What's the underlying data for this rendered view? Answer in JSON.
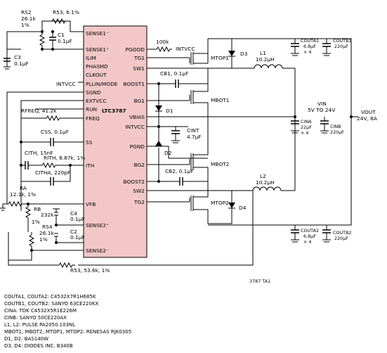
{
  "ic": {
    "part": "LTC3787",
    "pins_left": [
      "SENSE1⁻",
      "SENSE1⁺",
      "ILIM",
      "PHASMD",
      "CLKOUT",
      "PLLIN/MODE",
      "SGND",
      "EXTVCC",
      "RUN",
      "FREQ",
      "SS",
      "ITH",
      "VFB",
      "SENSE2⁺",
      "SENSE2⁻"
    ],
    "pins_right": [
      "PGOOD",
      "TG1",
      "SW1",
      "BOOST1",
      "BG1",
      "VBIAS",
      "INTVCC",
      "PGND",
      "BG2",
      "BOOST2",
      "SW2",
      "TG2"
    ]
  },
  "components": {
    "rs2": "RS2",
    "rs2_val": "26.1k",
    "rs2_val2": "1%",
    "r53a": "R53, 6.1%",
    "r53b": "R53, 53.6k, 1%",
    "c1": "C1",
    "c1_val": "0.1µF",
    "c3": "C3",
    "c3_val": "0.1µF",
    "pgood_r": "100k",
    "intvcc_label": "INTVCC",
    "intvcc_left": "INTVCC",
    "cb1": "CB1, 0.1µF",
    "cb2": "CB2, 0.1µF",
    "rfreq": "RFREQ, 41.2k",
    "css": "CSS, 0.1µF",
    "cith": "CITH, 15nF",
    "rith": "RITH, 8.87k, 1%",
    "citha": "CITHA, 220pF",
    "ra": "RA",
    "ra_val": "12.1k, 1%",
    "rb": "RB",
    "rb_val": "232k",
    "rb_val2": "1%",
    "c4": "C4",
    "c4_val": "0.1µF",
    "c2": "C2",
    "c2_val": "0.1µF",
    "rs4": "RS4",
    "rs4_val": "26.1k",
    "rs4_val2": "1%",
    "cint": "CINT",
    "cint_val": "4.7µF",
    "d1": "D1",
    "d2": "D2",
    "d3": "D3",
    "d4": "D4",
    "mtop1": "MTOP1",
    "mbot1": "MBOT1",
    "mbot2": "MBOT2",
    "mtop2": "MTOP2",
    "l1": "L1",
    "l1_val": "10.2µH",
    "l2": "L2",
    "l2_val": "10.2µH",
    "couta1": "COUTA1",
    "couta1_val": "6.8µF",
    "couta1_n": "× 4",
    "coutb1": "COUTB1",
    "coutb1_val": "220µF",
    "cina": "CINA",
    "cina_val": "22µF",
    "cina_n": "× 4",
    "cinb": "CINB",
    "cinb_val": "220µF",
    "couta2": "COUTA2",
    "couta2_val": "6.8µF",
    "couta2_n": "× 4",
    "coutb2": "COUTB2",
    "coutb2_val": "220µF",
    "vin": "VIN",
    "vin_range": "5V TO 24V",
    "vout": "VOUT",
    "vout_val": "24V, 8A",
    "fig_id": "3787 TA1"
  },
  "notes": [
    "COUTA1, COUTA2: C4532X7R1H685K",
    "COUTB1, COUTB2: SANYO 63CE220KX",
    "CINA: TDK C4532X5R1E226M",
    "CINB: SANYO 50CE220AX",
    "L1, L2: PULSE PA2050.103NL",
    "MBOT1, MBOT2, MTOP1, MTOP2: RENESAS RJK0305",
    "D1, D2: BAS140W",
    "D3, D4: DIODES INC. B340B"
  ]
}
